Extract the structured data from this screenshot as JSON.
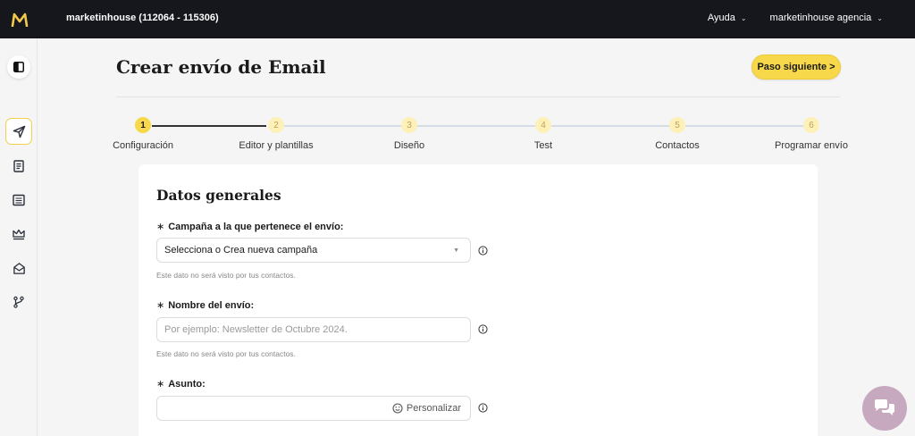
{
  "topbar": {
    "account": "marketinhouse (112064 - 115306)",
    "help_label": "Ayuda",
    "agency_label": "marketinhouse agencia"
  },
  "sidebar": {
    "items": [
      {
        "icon": "send-icon",
        "active": true
      },
      {
        "icon": "document-icon",
        "active": false
      },
      {
        "icon": "list-icon",
        "active": false
      },
      {
        "icon": "crown-icon",
        "active": false
      },
      {
        "icon": "mail-open-icon",
        "active": false
      },
      {
        "icon": "branch-icon",
        "active": false
      }
    ]
  },
  "page": {
    "title": "Crear envío de Email",
    "next_button": "Paso siguiente >"
  },
  "steps": [
    {
      "number": "1",
      "label": "Configuración",
      "active": true
    },
    {
      "number": "2",
      "label": "Editor y plantillas",
      "active": false
    },
    {
      "number": "3",
      "label": "Diseño",
      "active": false
    },
    {
      "number": "4",
      "label": "Test",
      "active": false
    },
    {
      "number": "5",
      "label": "Contactos",
      "active": false
    },
    {
      "number": "6",
      "label": "Programar envío",
      "active": false
    }
  ],
  "form": {
    "title": "Datos generales",
    "campaign": {
      "label": "Campaña a la que pertenece el envío:",
      "value": "Selecciona o Crea nueva campaña",
      "help": "Este dato no será visto por tus contactos."
    },
    "name": {
      "label": "Nombre del envío:",
      "placeholder": "Por ejemplo: Newsletter de Octubre 2024.",
      "help": "Este dato no será visto por tus contactos."
    },
    "subject": {
      "label": "Asunto:",
      "personalize": "Personalizar"
    }
  },
  "colors": {
    "accent": "#f7d84a",
    "topbar": "#15171c",
    "chat": "#c7a9bf"
  }
}
